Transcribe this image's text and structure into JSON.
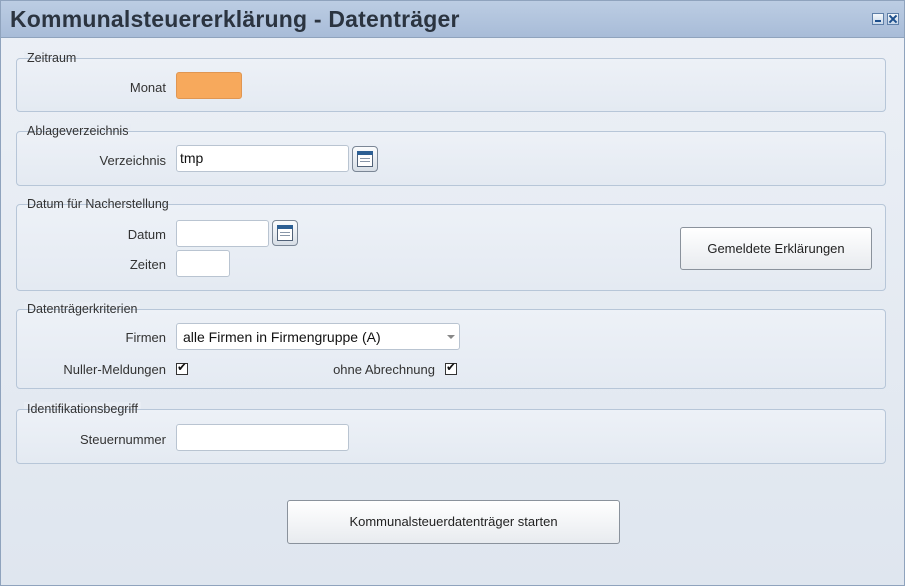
{
  "window": {
    "title": "Kommunalsteuererklärung - Datenträger",
    "controls": [
      "minimize-icon",
      "close-icon"
    ]
  },
  "zeitraum": {
    "legend": "Zeitraum",
    "monat_label": "Monat",
    "monat_value": ""
  },
  "ablage": {
    "legend": "Ablageverzeichnis",
    "verzeichnis_label": "Verzeichnis",
    "verzeichnis_value": "tmp"
  },
  "nacherstellung": {
    "legend": "Datum für Nacherstellung",
    "datum_label": "Datum",
    "datum_value": "",
    "zeiten_label": "Zeiten",
    "zeiten_value": "",
    "gemeldete_button": "Gemeldete Erklärungen"
  },
  "kriterien": {
    "legend": "Datenträgerkriterien",
    "firmen_label": "Firmen",
    "firmen_selected": "alle Firmen in Firmengruppe (A)",
    "nuller_label": "Nuller-Meldungen",
    "nuller_checked": true,
    "ohne_label": "ohne Abrechnung",
    "ohne_checked": true,
    "check_glyph": "✔"
  },
  "ident": {
    "legend": "Identifikationsbegriff",
    "steuernummer_label": "Steuernummer",
    "steuernummer_value": ""
  },
  "actions": {
    "start_button": "Kommunalsteuerdatenträger starten"
  },
  "colors": {
    "monat_field": "#f7a95c",
    "titlebar": "#b3c6df"
  }
}
